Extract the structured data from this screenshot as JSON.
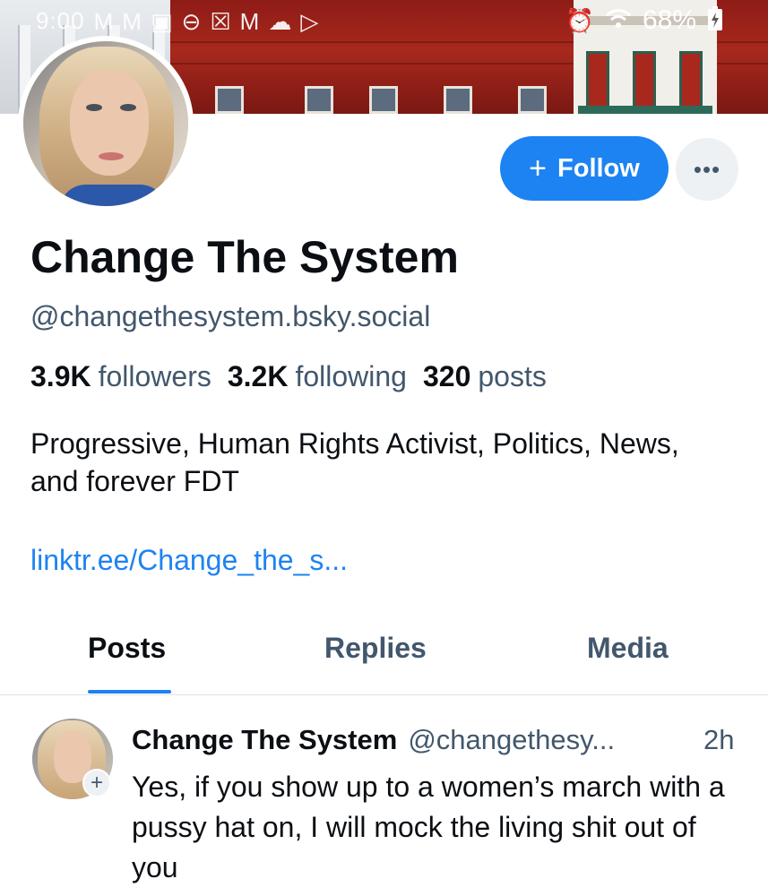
{
  "status_bar": {
    "time": "9:00",
    "left_icons": [
      "M",
      "M",
      "▣",
      "⊖",
      "☒",
      "M",
      "☁",
      "▷"
    ],
    "right_icons": [
      "alarm-icon",
      "wifi-icon"
    ],
    "battery": "68%"
  },
  "profile": {
    "display_name": "Change The System",
    "handle": "@changethesystem.bsky.social",
    "stats": {
      "followers_count": "3.9K",
      "followers_label": "followers",
      "following_count": "3.2K",
      "following_label": "following",
      "posts_count": "320",
      "posts_label": "posts"
    },
    "bio": "Progressive, Human Rights Activist, Politics, News, and forever FDT",
    "link": "linktr.ee/Change_the_s..."
  },
  "actions": {
    "follow_label": "Follow",
    "follow_icon": "+",
    "more_icon": "•••"
  },
  "tabs": {
    "posts": "Posts",
    "replies": "Replies",
    "media": "Media",
    "active": "posts"
  },
  "post": {
    "author": "Change The System",
    "handle": "@changethesy...",
    "time": "2h",
    "text": "Yes, if you show up to a women’s march with a pussy hat on, I will mock the living shit out of you",
    "follow_badge": "+"
  },
  "colors": {
    "accent": "#1d83f2",
    "text_primary": "#0b0f14",
    "text_secondary": "#42576c",
    "divider": "#dfe3e8"
  }
}
